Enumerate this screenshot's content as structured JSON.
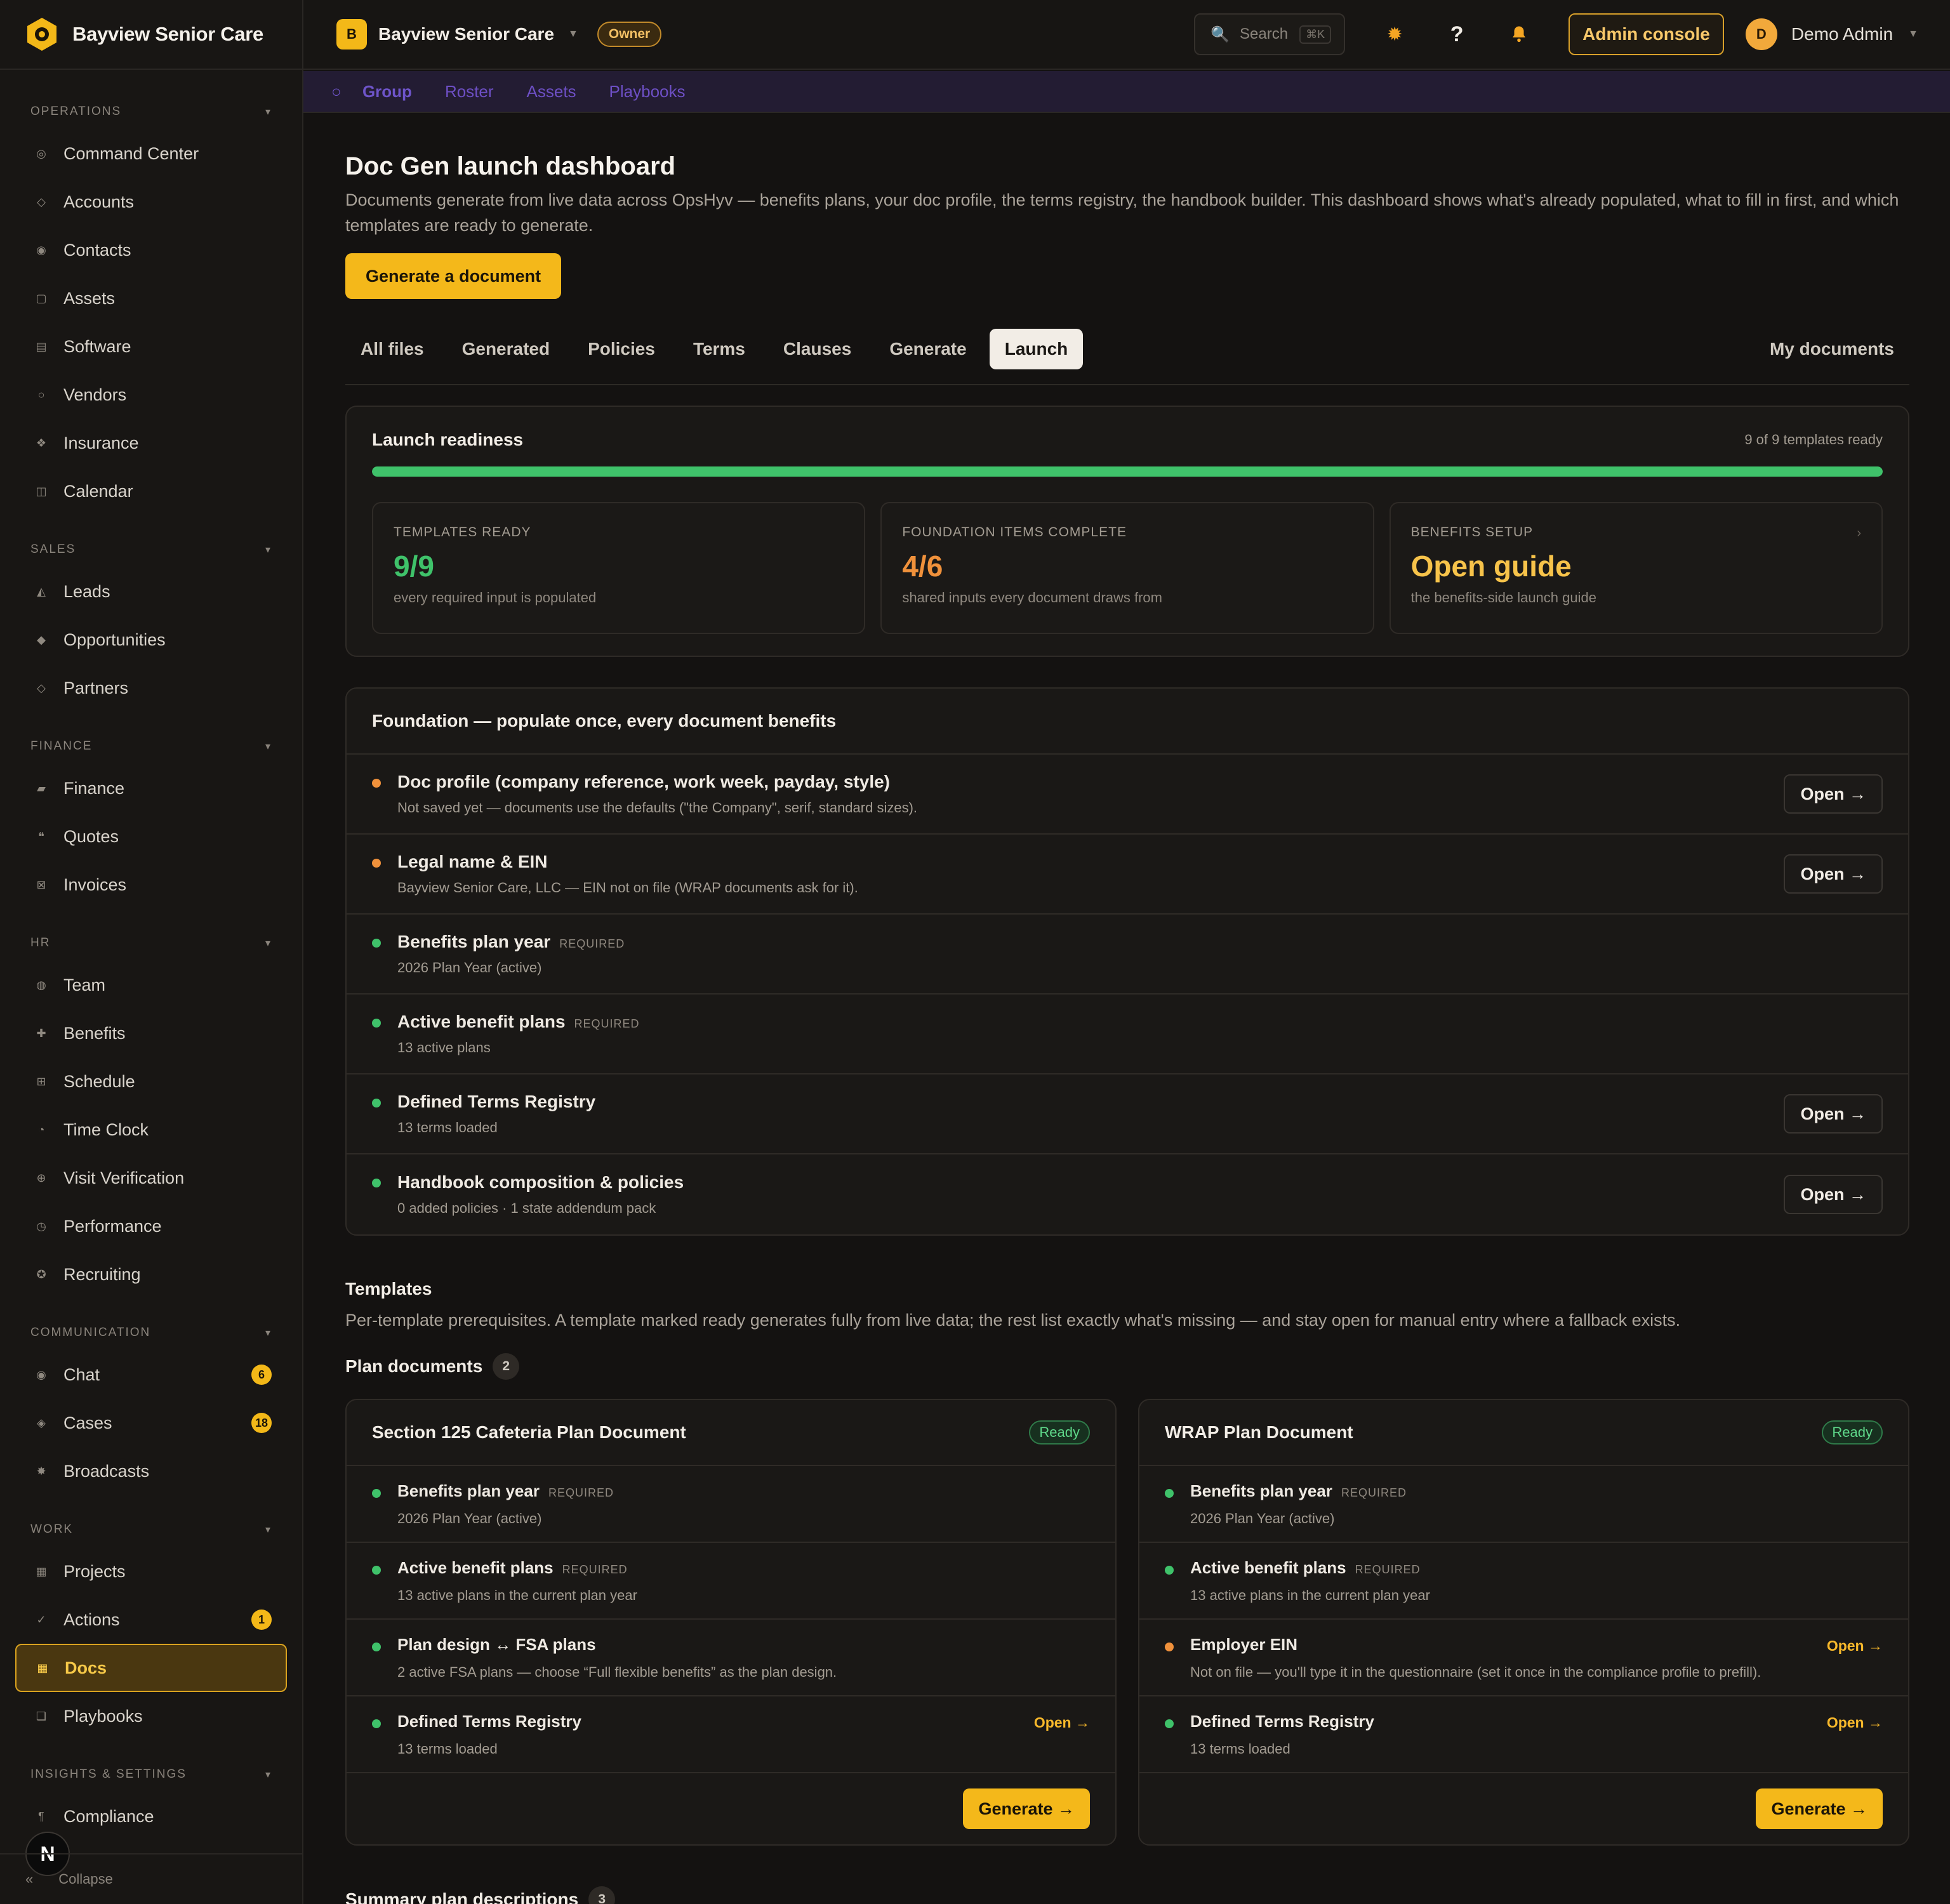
{
  "sidebar": {
    "brand": "Bayview Senior Care",
    "sections": [
      {
        "heading": "OPERATIONS",
        "items": [
          {
            "label": "Command Center",
            "icon": "target-icon"
          },
          {
            "label": "Accounts",
            "icon": "diamond-icon"
          },
          {
            "label": "Contacts",
            "icon": "person-icon"
          },
          {
            "label": "Assets",
            "icon": "box-icon"
          },
          {
            "label": "Software",
            "icon": "grid-icon"
          },
          {
            "label": "Vendors",
            "icon": "circle-icon"
          },
          {
            "label": "Insurance",
            "icon": "shield-icon"
          },
          {
            "label": "Calendar",
            "icon": "calendar-icon"
          }
        ]
      },
      {
        "heading": "SALES",
        "items": [
          {
            "label": "Leads",
            "icon": "triangle-icon"
          },
          {
            "label": "Opportunities",
            "icon": "diamond-filled-icon"
          },
          {
            "label": "Partners",
            "icon": "diamond-icon"
          }
        ]
      },
      {
        "heading": "FINANCE",
        "items": [
          {
            "label": "Finance",
            "icon": "card-icon"
          },
          {
            "label": "Quotes",
            "icon": "quote-icon"
          },
          {
            "label": "Invoices",
            "icon": "invoice-icon"
          }
        ]
      },
      {
        "heading": "HR",
        "items": [
          {
            "label": "Team",
            "icon": "team-icon"
          },
          {
            "label": "Benefits",
            "icon": "plus-icon"
          },
          {
            "label": "Schedule",
            "icon": "schedule-icon"
          },
          {
            "label": "Time Clock",
            "icon": "clock-icon"
          },
          {
            "label": "Visit Verification",
            "icon": "globe-icon"
          },
          {
            "label": "Performance",
            "icon": "gauge-icon"
          },
          {
            "label": "Recruiting",
            "icon": "recruit-icon"
          }
        ]
      },
      {
        "heading": "COMMUNICATION",
        "items": [
          {
            "label": "Chat",
            "icon": "chat-icon",
            "badge": "6"
          },
          {
            "label": "Cases",
            "icon": "case-icon",
            "badge": "18"
          },
          {
            "label": "Broadcasts",
            "icon": "broadcast-icon"
          }
        ]
      },
      {
        "heading": "WORK",
        "items": [
          {
            "label": "Projects",
            "icon": "projects-icon"
          },
          {
            "label": "Actions",
            "icon": "check-icon",
            "badge": "1"
          },
          {
            "label": "Docs",
            "icon": "docs-icon",
            "active": true
          },
          {
            "label": "Playbooks",
            "icon": "playbook-icon"
          }
        ]
      },
      {
        "heading": "INSIGHTS & SETTINGS",
        "items": [
          {
            "label": "Compliance",
            "icon": "compliance-icon"
          }
        ]
      }
    ],
    "collapse_label": "Collapse",
    "collapse_glyph": "«",
    "n_badge": "N"
  },
  "topbar": {
    "org_initial": "B",
    "org_name": "Bayview Senior Care",
    "role": "Owner",
    "search_placeholder": "Search",
    "search_shortcut": "⌘K",
    "admin_label": "Admin console",
    "user_initial": "D",
    "user_name": "Demo Admin"
  },
  "subnav": [
    "Group",
    "Roster",
    "Assets",
    "Playbooks"
  ],
  "page": {
    "title": "Doc Gen launch dashboard",
    "description": "Documents generate from live data across OpsHyv — benefits plans, your doc profile, the terms registry, the handbook builder. This dashboard shows what's already populated, what to fill in first, and which templates are ready to generate.",
    "primary_action": "Generate a document"
  },
  "tabs": [
    {
      "label": "All files"
    },
    {
      "label": "Generated"
    },
    {
      "label": "Policies"
    },
    {
      "label": "Terms"
    },
    {
      "label": "Clauses"
    },
    {
      "label": "Generate"
    },
    {
      "label": "Launch",
      "active": true
    }
  ],
  "tab_right": "My documents",
  "readiness": {
    "title": "Launch readiness",
    "count_text": "9 of 9 templates ready",
    "progress": 1.0,
    "stats": [
      {
        "label": "TEMPLATES READY",
        "value": "9/9",
        "sub": "every required input is populated",
        "tone": "green"
      },
      {
        "label": "FOUNDATION ITEMS COMPLETE",
        "value": "4/6",
        "sub": "shared inputs every document draws from",
        "tone": "orange"
      },
      {
        "label": "BENEFITS SETUP",
        "value": "Open guide",
        "sub": "the benefits-side launch guide",
        "tone": "yellow",
        "arrow": "›"
      }
    ]
  },
  "foundation": {
    "title": "Foundation — populate once, every document benefits",
    "items": [
      {
        "title": "Doc profile (company reference, work week, payday, style)",
        "sub": "Not saved yet — documents use the defaults (\"the Company\", serif, standard sizes).",
        "status": "warn",
        "action": "Open →"
      },
      {
        "title": "Legal name & EIN",
        "sub": "Bayview Senior Care, LLC — EIN not on file (WRAP documents ask for it).",
        "status": "warn",
        "action": "Open →"
      },
      {
        "title": "Benefits plan year",
        "req": "REQUIRED",
        "sub": "2026 Plan Year (active)",
        "status": "ok"
      },
      {
        "title": "Active benefit plans",
        "req": "REQUIRED",
        "sub": "13 active plans",
        "status": "ok"
      },
      {
        "title": "Defined Terms Registry",
        "sub": "13 terms loaded",
        "status": "ok",
        "action": "Open →"
      },
      {
        "title": "Handbook composition & policies",
        "sub": "0 added policies · 1 state addendum pack",
        "status": "ok",
        "action": "Open →"
      }
    ]
  },
  "templates": {
    "title": "Templates",
    "description": "Per-template prerequisites. A template marked ready generates fully from live data; the rest list exactly what's missing — and stay open for manual entry where a fallback exists.",
    "groups": [
      {
        "name": "Plan documents",
        "count": "2"
      },
      {
        "name": "Summary plan descriptions",
        "count": "3"
      }
    ],
    "cards": [
      {
        "name": "Section 125 Cafeteria Plan Document",
        "status": "Ready",
        "generate": "Generate →",
        "items": [
          {
            "title": "Benefits plan year",
            "req": "REQUIRED",
            "sub": "2026 Plan Year (active)",
            "status": "ok"
          },
          {
            "title": "Active benefit plans",
            "req": "REQUIRED",
            "sub": "13 active plans in the current plan year",
            "status": "ok"
          },
          {
            "title": "Plan design ↔ FSA plans",
            "sub": "2 active FSA plans — choose “Full flexible benefits” as the plan design.",
            "status": "ok"
          },
          {
            "title": "Defined Terms Registry",
            "sub": "13 terms loaded",
            "status": "ok",
            "link": "Open →"
          }
        ]
      },
      {
        "name": "WRAP Plan Document",
        "status": "Ready",
        "generate": "Generate →",
        "items": [
          {
            "title": "Benefits plan year",
            "req": "REQUIRED",
            "sub": "2026 Plan Year (active)",
            "status": "ok"
          },
          {
            "title": "Active benefit plans",
            "req": "REQUIRED",
            "sub": "13 active plans in the current plan year",
            "status": "ok"
          },
          {
            "title": "Employer EIN",
            "sub": "Not on file — you'll type it in the questionnaire (set it once in the compliance profile to prefill).",
            "status": "warn",
            "link": "Open →"
          },
          {
            "title": "Defined Terms Registry",
            "sub": "13 terms loaded",
            "status": "ok",
            "link": "Open →"
          }
        ]
      }
    ]
  },
  "colors": {
    "accent": "#f4b81a",
    "success": "#3fc26a",
    "warning": "#f0913b",
    "subnav": "#6d4fc4"
  }
}
